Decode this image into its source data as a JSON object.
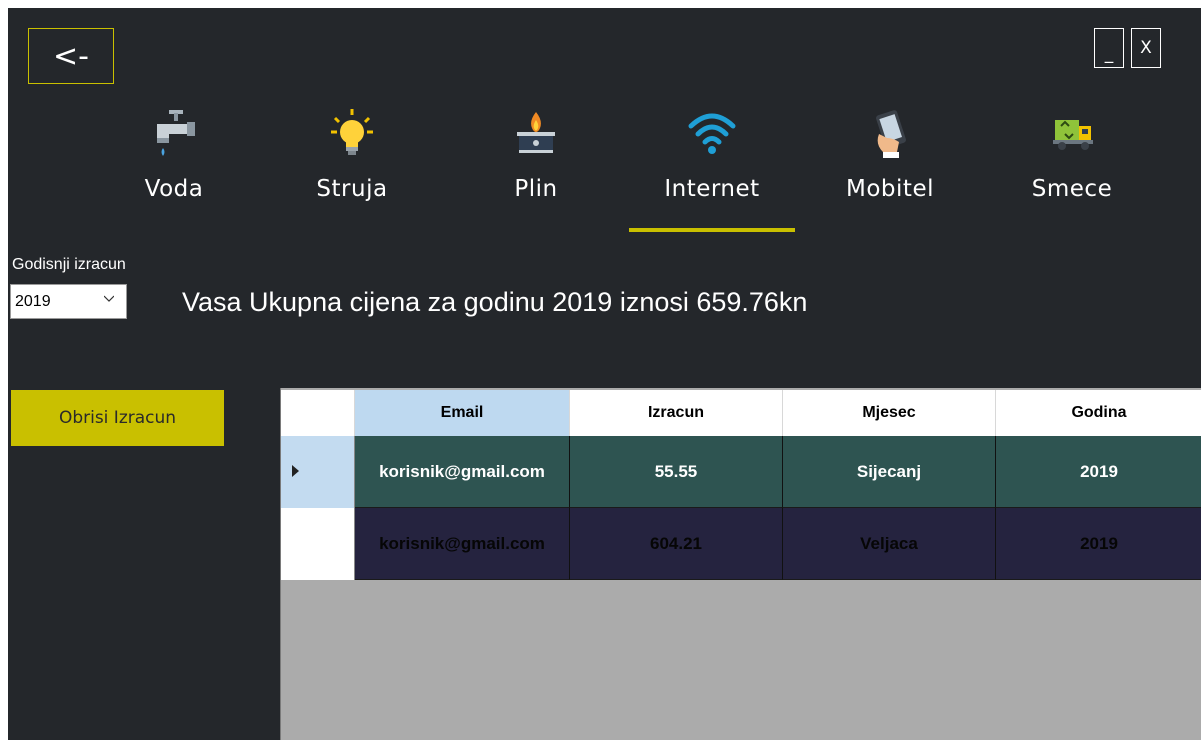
{
  "window": {
    "back_label": "<-",
    "minimize_label": "_",
    "close_label": "X"
  },
  "nav": {
    "active": "Internet",
    "accent": "#c9c000",
    "items": [
      {
        "label": "Voda",
        "icon": "water-tap-icon"
      },
      {
        "label": "Struja",
        "icon": "light-bulb-icon"
      },
      {
        "label": "Plin",
        "icon": "gas-stove-icon"
      },
      {
        "label": "Internet",
        "icon": "wifi-icon"
      },
      {
        "label": "Mobitel",
        "icon": "mobile-phone-icon"
      },
      {
        "label": "Smece",
        "icon": "garbage-truck-icon"
      }
    ]
  },
  "annual": {
    "label": "Godisnji izracun",
    "selected_year": "2019",
    "total_text": "Vasa Ukupna cijena za godinu 2019 iznosi 659.76kn"
  },
  "delete_button": "Obrisi Izracun",
  "grid": {
    "columns": [
      "Email",
      "Izracun",
      "Mjesec",
      "Godina"
    ],
    "selected_column": "Email",
    "rows": [
      {
        "email": "korisnik@gmail.com",
        "izracun": "55.55",
        "mjesec": "Sijecanj",
        "godina": "2019",
        "selected": true
      },
      {
        "email": "korisnik@gmail.com",
        "izracun": "604.21",
        "mjesec": "Veljaca",
        "godina": "2019",
        "selected": false
      }
    ]
  },
  "colors": {
    "background": "#24272b",
    "accent": "#c9c000",
    "row1": "#2e5451",
    "row2": "#25233f",
    "grid_empty": "#ababab"
  }
}
